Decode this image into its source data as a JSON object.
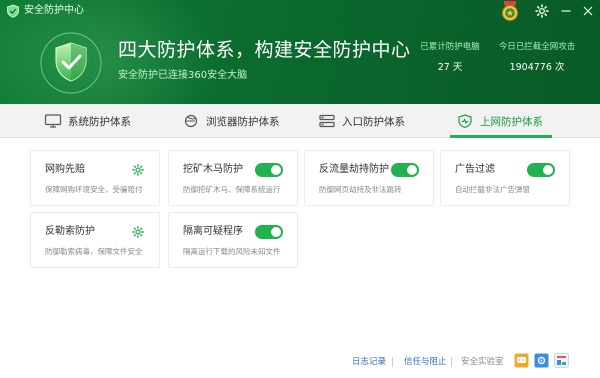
{
  "window": {
    "title": "安全防护中心"
  },
  "header": {
    "slogan": "四大防护体系，构建安全防护中心",
    "subtext": "安全防护已连接360安全大脑",
    "stats": [
      {
        "label": "已累计防护电脑",
        "value": "27 天"
      },
      {
        "label": "今日已拦截全网攻击",
        "value": "1904776 次"
      }
    ]
  },
  "tabs": [
    {
      "label": "系统防护体系",
      "icon": "monitor-icon"
    },
    {
      "label": "浏览器防护体系",
      "icon": "browser-icon"
    },
    {
      "label": "入口防护体系",
      "icon": "entry-icon"
    },
    {
      "label": "上网防护体系",
      "icon": "heart-shield-icon",
      "active": true
    }
  ],
  "cards": [
    {
      "name": "网购先赔",
      "desc": "保障网购环境安全，受骗赔付",
      "control": "gear"
    },
    {
      "name": "挖矿木马防护",
      "desc": "防御挖矿木马、保障系统运行",
      "control": "toggle",
      "on": true
    },
    {
      "name": "反流量劫持防护",
      "desc": "防御网页劫持及非法跳转",
      "control": "toggle",
      "on": true
    },
    {
      "name": "广告过滤",
      "desc": "自动拦截非法广告弹窗",
      "control": "toggle",
      "on": true
    },
    {
      "name": "反勒索防护",
      "desc": "防御勒索病毒，保障文件安全",
      "control": "gear"
    },
    {
      "name": "隔离可疑程序",
      "desc": "隔离运行下载的风险未知文件",
      "control": "toggle",
      "on": true
    }
  ],
  "footer": {
    "log_link": "日志记录",
    "trust_link": "信任与阻止",
    "lab_link": "安全实验室"
  },
  "colors": {
    "brand_green": "#0b6a2e",
    "toggle_on": "#21b352",
    "link_blue": "#2e6fc9"
  }
}
